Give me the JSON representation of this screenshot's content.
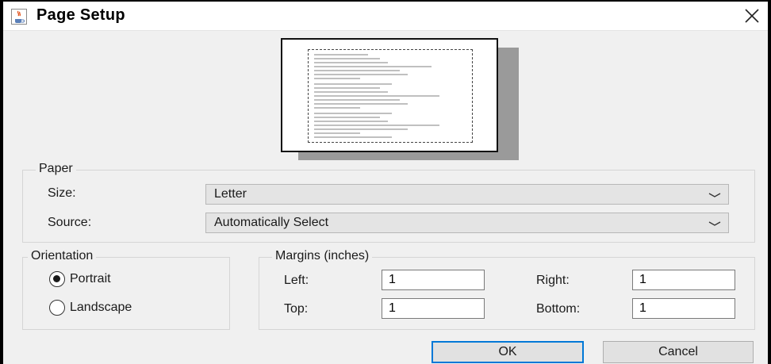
{
  "window": {
    "title": "Page Setup",
    "app_icon": "java-cup-icon",
    "close_icon": "close-icon"
  },
  "paper": {
    "legend": "Paper",
    "size_label": "Size:",
    "size_value": "Letter",
    "source_label": "Source:",
    "source_value": "Automatically Select"
  },
  "orientation": {
    "legend": "Orientation",
    "portrait_label": "Portrait",
    "landscape_label": "Landscape",
    "selected": "Portrait"
  },
  "margins": {
    "legend": "Margins (inches)",
    "left_label": "Left:",
    "left_value": "1",
    "right_label": "Right:",
    "right_value": "1",
    "top_label": "Top:",
    "top_value": "1",
    "bottom_label": "Bottom:",
    "bottom_value": "1"
  },
  "buttons": {
    "ok": "OK",
    "cancel": "Cancel"
  },
  "colors": {
    "accent": "#0078d7",
    "dialog_bg": "#f0f0f0"
  }
}
